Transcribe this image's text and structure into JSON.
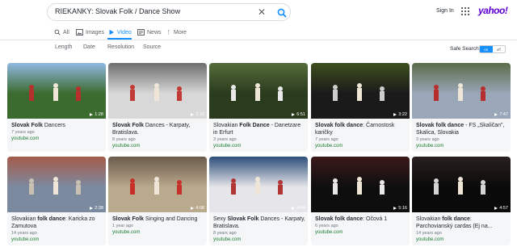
{
  "search": {
    "query": "RIEKANKY: Slovak Folk / Dance Show",
    "clear_icon": "close-icon",
    "submit_icon": "search-icon"
  },
  "header": {
    "signin": "Sign In",
    "logo": "yahoo!",
    "apps_icon": "apps-grid-icon"
  },
  "tabs": [
    {
      "label": "All",
      "icon": "search-icon"
    },
    {
      "label": "Images",
      "icon": "image-icon"
    },
    {
      "label": "Video",
      "icon": "play-icon",
      "active": true
    },
    {
      "label": "News",
      "icon": "news-icon"
    },
    {
      "label": "More",
      "icon": "more-vertical-icon"
    }
  ],
  "filters": [
    "Length",
    "Date",
    "Resolution",
    "Source"
  ],
  "safe_search": {
    "label": "Safe Search",
    "on": "on",
    "off": "off"
  },
  "videos": [
    {
      "pre": "",
      "bold": "Slovak Folk",
      "post": " Dancers",
      "duration": "1:28",
      "age": "7 years ago",
      "source": "youtube.com"
    },
    {
      "pre": "",
      "bold": "Slovak Folk",
      "post": " Dances - Karpaty, Bratislava.",
      "duration": "2:10",
      "age": "8 years ago",
      "source": "youtube.com"
    },
    {
      "pre": "Slovakian ",
      "bold": "Folk Dance",
      "post": " - Danetzare in Erfurt",
      "duration": "6:51",
      "age": "3 years ago",
      "source": "youtube.com"
    },
    {
      "pre": "",
      "bold": "Slovak folk dance",
      "post": ": Čarnostosk karičky",
      "duration": "3:22",
      "age": "7 years ago",
      "source": "youtube.com"
    },
    {
      "pre": "",
      "bold": "Slovak folk dance",
      "post": " - FS „Skaličan\", Skalica, Slovakia",
      "duration": "7:47",
      "age": "3 years ago",
      "source": "youtube.com"
    },
    {
      "pre": "Slovakian ",
      "bold": "folk dance",
      "post": ": Karicka zo Zamutova",
      "duration": "2:38",
      "age": "14 years ago",
      "source": "youtube.com"
    },
    {
      "pre": "",
      "bold": "Slovak Folk",
      "post": " Singing and Dancing",
      "duration": "4:08",
      "age": "1 year ago",
      "source": "youtube.com"
    },
    {
      "pre": "Sexy ",
      "bold": "Slovak Folk",
      "post": " Dances - Karpaty, Bratislava.",
      "duration": "4:44",
      "age": "8 years ago",
      "source": "youtube.com"
    },
    {
      "pre": "",
      "bold": "Slovak folk dance",
      "post": ": Očová 1",
      "duration": "5:16",
      "age": "6 years ago",
      "source": "youtube.com"
    },
    {
      "pre": "Slovakian ",
      "bold": "folk dance",
      "post": ": Parchovianský cardas (Ej na...",
      "duration": "4:57",
      "age": "14 years ago",
      "source": "youtube.com"
    }
  ]
}
